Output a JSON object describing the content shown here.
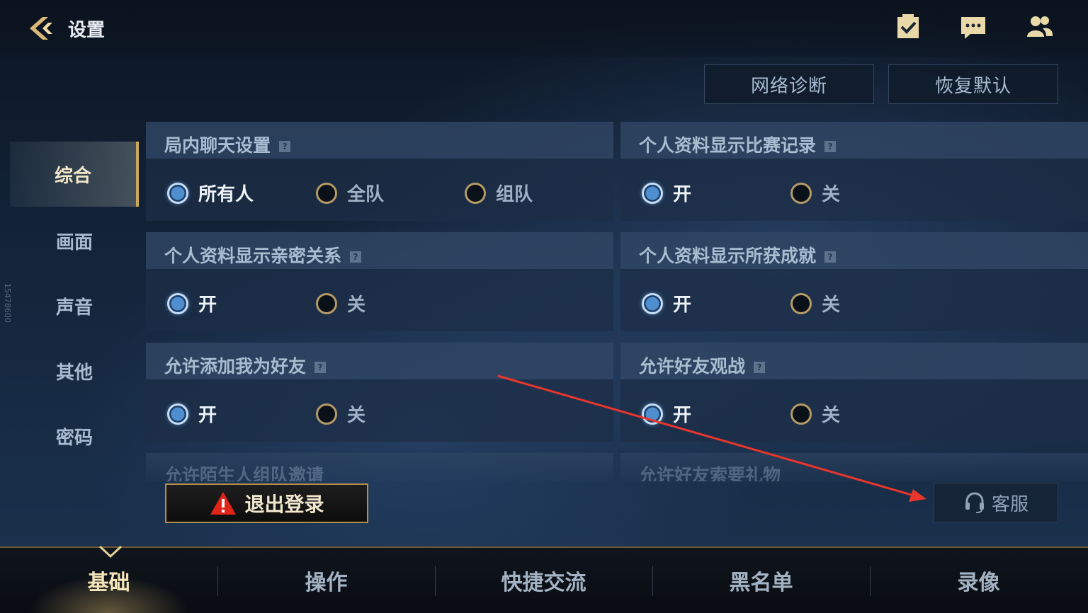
{
  "header": {
    "title": "设置",
    "buttons": [
      {
        "label": "网络诊断"
      },
      {
        "label": "恢复默认"
      }
    ]
  },
  "sidebar": {
    "items": [
      {
        "label": "综合",
        "active": true
      },
      {
        "label": "画面",
        "active": false
      },
      {
        "label": "声音",
        "active": false
      },
      {
        "label": "其他",
        "active": false
      },
      {
        "label": "密码",
        "active": false
      }
    ]
  },
  "settings": [
    {
      "title": "局内聊天设置",
      "options": [
        "所有人",
        "全队",
        "组队"
      ],
      "selected": 0
    },
    {
      "title": "个人资料显示比赛记录",
      "options": [
        "开",
        "关"
      ],
      "selected": 0
    },
    {
      "title": "个人资料显示亲密关系",
      "options": [
        "开",
        "关"
      ],
      "selected": 0
    },
    {
      "title": "个人资料显示所获成就",
      "options": [
        "开",
        "关"
      ],
      "selected": 0
    },
    {
      "title": "允许添加我为好友",
      "options": [
        "开",
        "关"
      ],
      "selected": 0
    },
    {
      "title": "允许好友观战",
      "options": [
        "开",
        "关"
      ],
      "selected": 0
    },
    {
      "title": "允许陌生人组队邀请"
    },
    {
      "title": "允许好友索要礼物"
    }
  ],
  "help_mark": "?",
  "actions": {
    "logout_label": "退出登录",
    "service_label": "客服"
  },
  "watermark": "15478600",
  "bottom_tabs": [
    {
      "label": "基础",
      "active": true
    },
    {
      "label": "操作",
      "active": false
    },
    {
      "label": "快捷交流",
      "active": false
    },
    {
      "label": "黑名单",
      "active": false
    },
    {
      "label": "录像",
      "active": false
    }
  ],
  "colors": {
    "accent_gold": "#c9a85c",
    "radio_on": "#4f8fd0",
    "annotation_arrow": "#e8362c",
    "warning_red": "#e2231a"
  },
  "icons": [
    "back-arrow-icon",
    "task-checklist-icon",
    "chat-bubble-icon",
    "friends-icon",
    "warning-icon",
    "headset-icon"
  ]
}
